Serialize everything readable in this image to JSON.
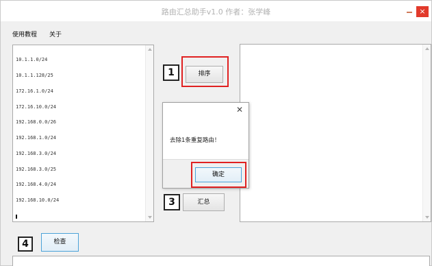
{
  "window": {
    "title": "路由汇总助手v1.0  作者：张学峰",
    "close_glyph": "×"
  },
  "menu": {
    "items": [
      "使用教程",
      "关于"
    ]
  },
  "input": {
    "routes": [
      "10.1.1.0/24",
      "10.1.1.128/25",
      "172.16.1.0/24",
      "172.16.10.0/24",
      "192.168.0.0/26",
      "192.168.1.0/24",
      "192.168.3.0/24",
      "192.168.3.0/25",
      "192.168.4.0/24",
      "192.168.10.0/24"
    ]
  },
  "buttons": {
    "sort": "排序",
    "summarize": "汇总",
    "check": "检查"
  },
  "steps": {
    "one": "1",
    "three": "3",
    "four": "4"
  },
  "dialog": {
    "close_glyph": "✕",
    "message": "去除1条重复路由！",
    "ok": "确定"
  },
  "annotation_color": "#e02020"
}
